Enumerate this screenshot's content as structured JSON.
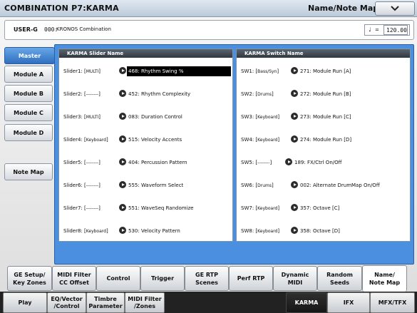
{
  "header": {
    "title": "COMBINATION P7:KARMA",
    "page_name": "Name/Note Map"
  },
  "icons": {
    "menu": "chevron-down-icon",
    "tempo": "quarter-note-icon",
    "select": "right-arrow-circle-icon"
  },
  "combi": {
    "bank": "USER-G",
    "number": "000:",
    "name": "KRONOS Combination",
    "tempo_symbol": "♩",
    "tempo_eq": "=",
    "tempo": "120.00"
  },
  "side_tabs": [
    "Master",
    "Module A",
    "Module B",
    "Module C",
    "Module D",
    "Note Map"
  ],
  "slider_group": {
    "title": "KARMA Slider Name",
    "rows": [
      {
        "label": "Slider1:",
        "mod": "MULTI",
        "value": "468: Rhythm Swing %"
      },
      {
        "label": "Slider2:",
        "mod": "--------",
        "value": "452: Rhythm Complexity"
      },
      {
        "label": "Slider3:",
        "mod": "MULTI",
        "value": "083: Duration Control"
      },
      {
        "label": "Slider4:",
        "mod": "Keyboard",
        "value": "515: Velocity Accents"
      },
      {
        "label": "Slider5:",
        "mod": "--------",
        "value": "404: Percussion Pattern"
      },
      {
        "label": "Slider6:",
        "mod": "--------",
        "value": "555: Waveform Select"
      },
      {
        "label": "Slider7:",
        "mod": "--------",
        "value": "551: WaveSeq Randomize"
      },
      {
        "label": "Slider8:",
        "mod": "Keyboard",
        "value": "530: Velocity Pattern"
      }
    ]
  },
  "switch_group": {
    "title": "KARMA Switch Name",
    "rows": [
      {
        "label": "SW1:",
        "mod": "Bass/Syn",
        "value": "271: Module Run [A]"
      },
      {
        "label": "SW2:",
        "mod": "Drums",
        "value": "272: Module Run [B]"
      },
      {
        "label": "SW3:",
        "mod": "Keyboard",
        "value": "273: Module Run [C]"
      },
      {
        "label": "SW4:",
        "mod": "Keyboard",
        "value": "274: Module Run [D]"
      },
      {
        "label": "SW5:",
        "mod": "--------",
        "value": "189: FX/Ctrl On/Off"
      },
      {
        "label": "SW6:",
        "mod": "Drums",
        "value": "002: Alternate DrumMap On/Off"
      },
      {
        "label": "SW7:",
        "mod": "Keyboard",
        "value": "357: Octave [C]"
      },
      {
        "label": "SW8:",
        "mod": "Keyboard",
        "value": "358: Octave [D]"
      }
    ]
  },
  "bottom_tabs": [
    "GE Setup/\nKey Zones",
    "MIDI Filter\nCC Offset",
    "Control",
    "Trigger",
    "GE RTP\nScenes",
    "Perf RTP",
    "Dynamic\nMIDI",
    "Random\nSeeds",
    "Name/\nNote Map"
  ],
  "page_tabs": [
    "Play",
    "EQ/Vector\n/Control",
    "Timbre\nParameter",
    "MIDI Filter\n/Zones",
    "KARMA",
    "IFX",
    "MFX/TFX"
  ],
  "colors": {
    "accent": "#4a8fe0",
    "active_tab": "#3d7fd0",
    "header_bar": "#3a424b"
  }
}
